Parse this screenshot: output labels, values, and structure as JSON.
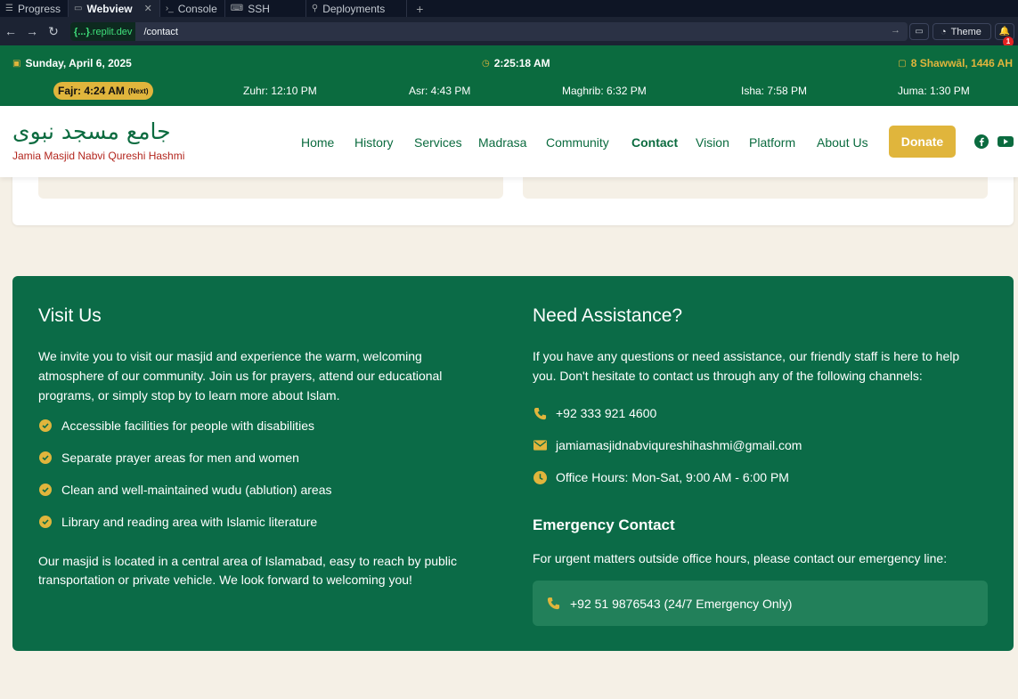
{
  "ide": {
    "tabs": [
      {
        "label": "Progress",
        "icon": "list-icon"
      },
      {
        "label": "Webview",
        "icon": "monitor-icon"
      },
      {
        "label": "Console",
        "icon": "terminal-icon"
      },
      {
        "label": "SSH",
        "icon": "key-icon"
      },
      {
        "label": "Deployments",
        "icon": "deploy-icon"
      }
    ],
    "url_host": ".replit.dev",
    "url_host_badge": "{...}",
    "url_path": "/contact",
    "theme_label": "Theme",
    "notification_count": "1"
  },
  "prayer_bar": {
    "date": "Sunday, April 6, 2025",
    "time": "2:25:18 AM",
    "hijri": "8 Shawwāl, 1446 AH",
    "fajr": "Fajr: 4:24 AM",
    "next_label": "(Next)",
    "zuhr": "Zuhr: 12:10 PM",
    "asr": "Asr: 4:43 PM",
    "maghrib": "Maghrib: 6:32 PM",
    "isha": "Isha: 7:58 PM",
    "juma": "Juma: 1:30 PM"
  },
  "header": {
    "logo_arabic": "جامع مسجد نبوی",
    "logo_english": "Jamia Masjid Nabvi Qureshi Hashmi",
    "nav": [
      "Home",
      "History",
      "Services",
      "Madrasa",
      "Community",
      "Contact",
      "Vision",
      "Platform",
      "About Us"
    ],
    "active_nav": "Contact",
    "donate_label": "Donate"
  },
  "visit": {
    "title": "Visit Us",
    "intro": "We invite you to visit our masjid and experience the warm, welcoming atmosphere of our community. Join us for prayers, attend our educational programs, or simply stop by to learn more about Islam.",
    "features": [
      "Accessible facilities for people with disabilities",
      "Separate prayer areas for men and women",
      "Clean and well-maintained wudu (ablution) areas",
      "Library and reading area with Islamic literature"
    ],
    "outro": "Our masjid is located in a central area of Islamabad, easy to reach by public transportation or private vehicle. We look forward to welcoming you!"
  },
  "assist": {
    "title": "Need Assistance?",
    "intro": "If you have any questions or need assistance, our friendly staff is here to help you. Don't hesitate to contact us through any of the following channels:",
    "phone": "+92 333 921 4600",
    "email": "jamiamasjidnabviqureshihashmi@gmail.com",
    "hours": "Office Hours: Mon-Sat, 9:00 AM - 6:00 PM",
    "emergency_title": "Emergency Contact",
    "emergency_text": "For urgent matters outside office hours, please contact our emergency line:",
    "emergency_phone": "+92 51 9876543 (24/7 Emergency Only)"
  },
  "colors": {
    "brand_green": "#0b6b3f",
    "gold": "#e0b53c",
    "page_bg": "#f5f0e6"
  }
}
